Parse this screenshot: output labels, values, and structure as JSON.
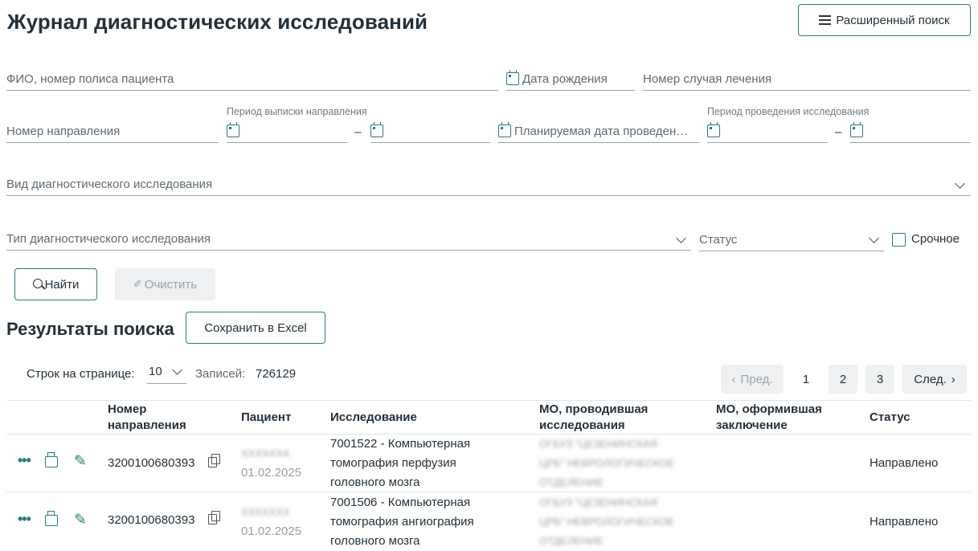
{
  "page": {
    "title": "Журнал диагностических исследований",
    "advanced_search_label": "Расширенный поиск"
  },
  "filters": {
    "patient_placeholder": "ФИО, номер полиса пациента",
    "birth_date_placeholder": "Дата рождения",
    "case_number_placeholder": "Номер случая лечения",
    "referral_number_placeholder": "Номер направления",
    "referral_period_label": "Период выписки направления",
    "planned_date_placeholder": "Планируемая дата проведен…",
    "study_period_label": "Период проведения исследования",
    "study_kind_placeholder": "Вид диагностического исследования",
    "study_type_placeholder": "Тип диагностического исследования",
    "status_placeholder": "Статус",
    "urgent_label": "Срочное",
    "dash": "–"
  },
  "actions": {
    "find_label": "Найти",
    "clear_label": "Очистить",
    "save_excel_label": "Сохранить в Excel"
  },
  "results": {
    "title": "Результаты поиска",
    "rows_per_page_label": "Строк на странице:",
    "rows_per_page_value": "10",
    "records_label": "Записей:",
    "records_count": "726129"
  },
  "pagination": {
    "prev_label": "Пред.",
    "next_label": "След.",
    "pages": [
      "1",
      "2",
      "3"
    ],
    "current_page": "1"
  },
  "table": {
    "columns": {
      "referral_number": "Номер направления",
      "patient": "Пациент",
      "study": "Исследование",
      "mo_performed": "МО, проводившая исследования",
      "mo_conclusion": "МО, оформившая заключение",
      "status": "Статус"
    },
    "rows": [
      {
        "referral_number": "3200100680393",
        "patient_name": "ХХХХХХХ",
        "patient_birth": "01.02.2025",
        "study_line1": "7001522 - Компьютерная",
        "study_line2": "томография перфузия",
        "study_line3": "головного мозга",
        "mo_line1": "ОГБУЗ \"ЦЕЗЕНИНСКАЯ",
        "mo_line2": "ЦРБ\" НЕВРОЛОГИЧЕСКОЕ",
        "mo_line3": "ОТДЕЛЕНИЕ",
        "status": "Направлено"
      },
      {
        "referral_number": "3200100680393",
        "patient_name": "ХХХХХХХ",
        "patient_birth": "01.02.2025",
        "study_line1": "7001506 - Компьютерная",
        "study_line2": "томография ангиография",
        "study_line3": "головного мозга",
        "mo_line1": "ОГБУЗ \"ЦЕЗЕНИНСКАЯ",
        "mo_line2": "ЦРБ\" НЕВРОЛОГИЧЕСКОЕ",
        "mo_line3": "ОТДЕЛЕНИЕ",
        "status": "Направлено"
      }
    ]
  },
  "colors": {
    "accent": "#2a7a7e",
    "heading": "#24303a",
    "muted": "#5f6b73"
  }
}
